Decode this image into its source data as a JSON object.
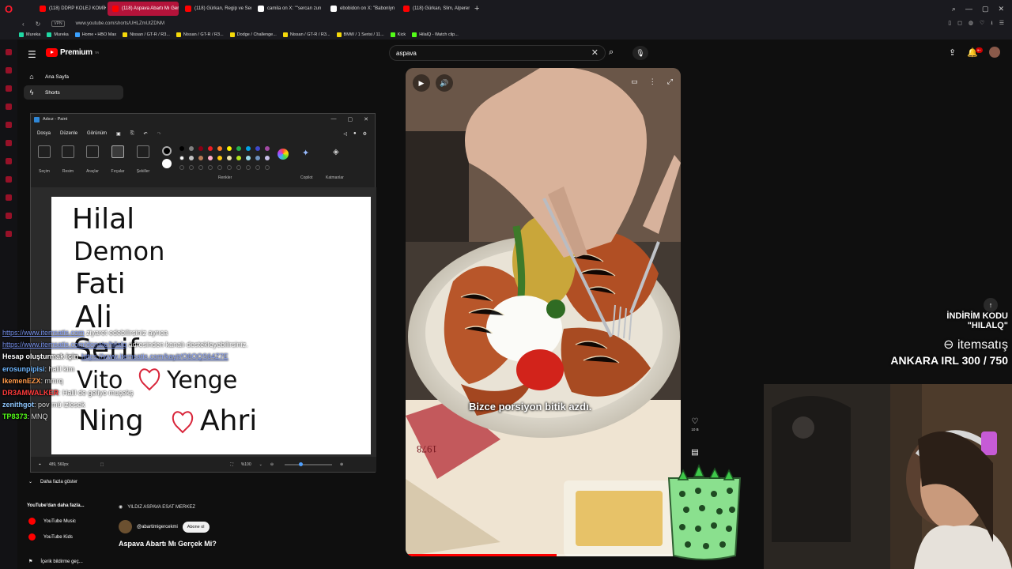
{
  "browser": {
    "tabs": [
      {
        "label": "(118) DDRP KOLEJ KOMİK",
        "active": false
      },
      {
        "label": "(118) Aspava Abartı Mı Ger",
        "active": true
      },
      {
        "label": "(118) Gürkan, Regip ve Sen",
        "active": false
      },
      {
        "label": "camila on X: \"\"sercan zun",
        "active": false
      },
      {
        "label": "ebobidon on X: \"Babonlyn",
        "active": false
      },
      {
        "label": "(118) Gürkan, Slim, Alperen",
        "active": false
      }
    ],
    "vpn_label": "VPN",
    "url": "www.youtube.com/shorts/UHLZmUtZDNM",
    "bookmarks": [
      "Mureka",
      "Mureka",
      "Home • HBO Max",
      "Nissan / GT-R / R3...",
      "Nissan / GT-R / R3...",
      "Dodge / Challenge...",
      "Nissan / GT-R / R3...",
      "BMW / 1 Serisi / 11...",
      "Kick",
      "HilalQ - Watch clip..."
    ]
  },
  "youtube": {
    "logo": "Premium",
    "logo_sup": "TR",
    "search_value": "aspava",
    "notification_count": "9+",
    "sidebar": {
      "items": [
        {
          "label": "Ana Sayfa",
          "icon": "home-icon",
          "active": false
        },
        {
          "label": "Shorts",
          "icon": "shorts-icon",
          "active": true
        }
      ],
      "show_more": "Daha fazla göster",
      "more_from_youtube": "YouTube'dan daha fazla...",
      "music": "YouTube Music",
      "kids": "YouTube Kids",
      "report": "İçerik bildirme geç..."
    },
    "short": {
      "caption": "Bizce porsiyon bitik azdı.",
      "likes": "10 B",
      "location": "YILDIZ ASPAVA ESAT MERKEZ",
      "channel": "@abartimigercekmi",
      "subscribe": "Abone ol",
      "title": "Aspava Abartı Mı Gerçek Mi?",
      "progress": 0.55
    }
  },
  "paint": {
    "title": "Adsız - Paint",
    "menu": [
      "Dosya",
      "Düzenle",
      "Görünüm"
    ],
    "tools": [
      "Seçim",
      "Resim",
      "Araçlar",
      "Fırçalar",
      "Şekiller"
    ],
    "colors_label": "Renkler",
    "copilot_label": "Copilot",
    "layers_label": "Katmanlar",
    "status_coords": "489, 560px",
    "zoom": "%100",
    "handwriting": [
      "Hilal",
      "Demon",
      "Fati",
      "Ali",
      "Serif",
      "Vito",
      "Yenge",
      "Ning",
      "Ahri"
    ],
    "palette": [
      "#000000",
      "#7f7f7f",
      "#880015",
      "#ed1c24",
      "#ff7f27",
      "#fff200",
      "#22b14c",
      "#00a2e8",
      "#3f48cc",
      "#a349a4",
      "#ffffff",
      "#c3c3c3",
      "#b97a57",
      "#ffaec9",
      "#ffc90e",
      "#efe4b0",
      "#b5e61d",
      "#99d9ea",
      "#7092be",
      "#c8bfe7"
    ]
  },
  "chat": [
    {
      "user": "",
      "user_color": "",
      "link": "https://www.itemsatis.com",
      "text": " ziyaret edebilirsiniz ayrıca"
    },
    {
      "user": "",
      "user_color": "",
      "link": "https://www.itemsatis.com/donate/hilalq",
      "text": " adresinden kanalı destekleyebilirsiniz."
    },
    {
      "user": "Hesap oluşturmak için",
      "user_color": "#ffffff",
      "link": "https://www.itemsatis.com/kayit/O6OQS64Z7E",
      "text": ""
    },
    {
      "user": "erosunpipisi",
      "user_color": "#6fb7ff",
      "link": "",
      "text": ": halil kim"
    },
    {
      "user": "IkemenEZX",
      "user_color": "#ff9a4a",
      "link": "",
      "text": ": mmrq"
    },
    {
      "user": "DR3AMWALKER",
      "user_color": "#ff3b3b",
      "link": "",
      "text": ": Halil de geliyo muçekş"
    },
    {
      "user": "zenithgot",
      "user_color": "#8fc7ff",
      "link": "",
      "text": ": pov mü izlesek"
    },
    {
      "user": "TP8373",
      "user_color": "#53fc18",
      "link": "",
      "text": ": MNQ"
    }
  ],
  "overlay": {
    "promo_line1": "İNDİRİM KODU",
    "promo_line2": "\"HILALQ\"",
    "brand": "itemsatış",
    "stat": "ANKARA IRL 300 / 750"
  }
}
